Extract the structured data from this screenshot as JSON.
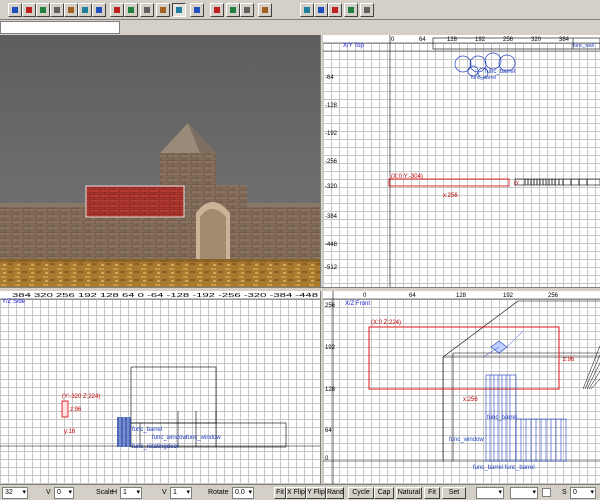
{
  "toolbar": {
    "tools": [
      {
        "name": "move",
        "icon": "move-icon"
      },
      {
        "name": "scale",
        "icon": "scale-icon"
      },
      {
        "name": "rotate",
        "icon": "rotate-icon"
      },
      {
        "name": "vertex",
        "icon": "vertex-icon"
      },
      {
        "name": "flip",
        "icon": "flip-icon"
      },
      {
        "name": "clip",
        "icon": "clip-icon"
      },
      {
        "name": "carve",
        "icon": "carve-icon"
      },
      {
        "name": "hollow",
        "icon": "hollow-icon"
      },
      {
        "name": "group",
        "icon": "group-icon"
      },
      {
        "name": "entity",
        "icon": "entity-icon"
      },
      {
        "name": "texture",
        "icon": "texture-icon"
      },
      {
        "name": "select",
        "icon": "cursor-icon"
      },
      {
        "name": "camera",
        "icon": "camera-icon"
      },
      {
        "name": "brush",
        "icon": "brush-icon"
      },
      {
        "name": "path",
        "icon": "path-icon"
      },
      {
        "name": "compile",
        "icon": "compile-icon"
      },
      {
        "name": "run",
        "icon": "run-icon"
      },
      {
        "name": "view-x",
        "icon": "x-icon"
      },
      {
        "name": "view-y",
        "icon": "y-icon"
      },
      {
        "name": "view-z",
        "icon": "z-icon"
      },
      {
        "name": "view-3d",
        "icon": "arrow-up-icon"
      },
      {
        "name": "view-eye",
        "icon": "eye-icon"
      }
    ]
  },
  "views": {
    "xy": {
      "label": "X/Y Top",
      "top_ruler": [
        "0",
        "64",
        "128",
        "192",
        "256",
        "320",
        "384"
      ],
      "left_ruler": [
        "-64",
        "-128",
        "-192",
        "-256",
        "-320",
        "-384",
        "-448",
        "-512"
      ],
      "entity_label_1": "func_barrel",
      "entity_label_2": "func_barrel",
      "entity_label_3": "func_wall",
      "brush_coord": "(X:0  Y:-304)",
      "brush_size": "x:256",
      "edge_label": "(Y"
    },
    "yz": {
      "label": "Y/Z Side",
      "top_ruler": "384 320 256 192 128 64 0 -64 -128 -192 -256 -320 -384 -448",
      "brush_coord": "(Y:-320  Z:224)",
      "size_z": "z:96",
      "size_y": "y:16",
      "ent_barrel": "func_barrel",
      "ent_window_1": "func_window",
      "ent_window_2": "func_window",
      "ent_door": "func_rotatingdoor"
    },
    "xz": {
      "label": "X/Z Front",
      "top_ruler": [
        "0",
        "64",
        "128",
        "192",
        "256"
      ],
      "left_ruler": [
        "256",
        "192",
        "128",
        "64",
        "0"
      ],
      "brush_coord": "(X:0  Z:224)",
      "size_z": "z:96",
      "size_x": "x:256",
      "ent_barrel": "func_barrel",
      "ent_window": "func_window",
      "ent_bottom": "func_barrel func_barrel"
    }
  },
  "statusbar": {
    "grid_value": "32",
    "v_label": "V",
    "v_value": "0",
    "scale_label": "Scale",
    "h_label": "H",
    "h_value": "1",
    "v2_label": "V",
    "v2_value": "1",
    "rotate_label": "Rotate",
    "rotate_value": "0.0",
    "fit_label": "Fit",
    "xflip_label": "X Flip",
    "yflip_label": "Y Flip",
    "rand_label": "Rand",
    "cycle_label": "Cycle",
    "cap_label": "Cap",
    "natural_label": "Natural",
    "fit2_label": "Fit",
    "set_label": "Set",
    "s_label": "S",
    "s_value": "0"
  }
}
